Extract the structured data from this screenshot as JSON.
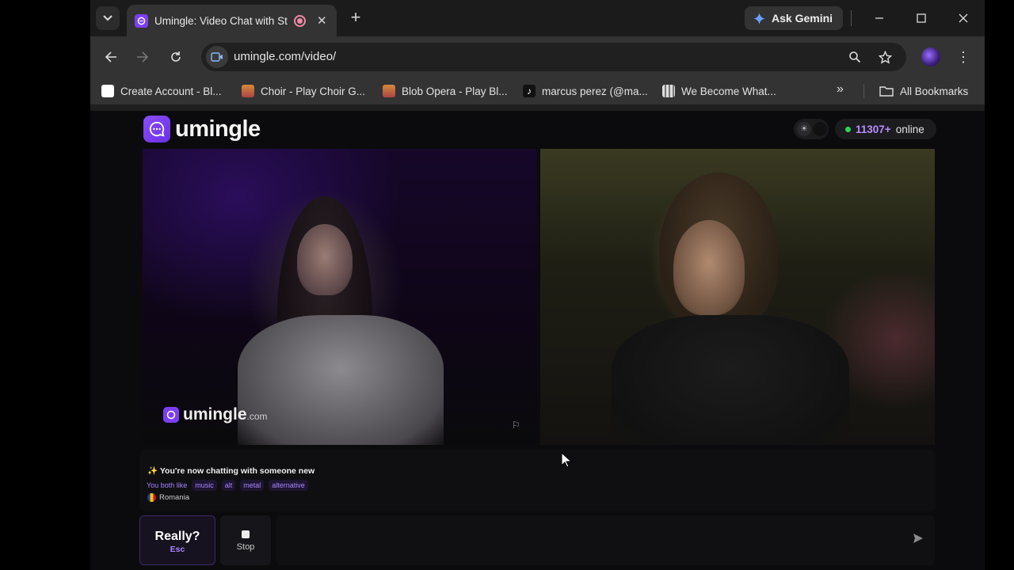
{
  "browser": {
    "tab_title": "Umingle: Video Chat with St",
    "new_tab_label": "+",
    "gemini_label": "Ask Gemini",
    "url": "umingle.com/video/",
    "bookmarks": [
      {
        "label": "Create Account - Bl...",
        "icon_color": "#ffffff"
      },
      {
        "label": "Choir - Play Choir G...",
        "icon_color": "#d6893b"
      },
      {
        "label": "Blob Opera - Play Bl...",
        "icon_color": "#d6893b"
      },
      {
        "label": "marcus perez (@ma...",
        "icon_color": "#ffffff"
      },
      {
        "label": "We Become What...",
        "icon_color": "#cccccc"
      }
    ],
    "all_bookmarks_label": "All Bookmarks"
  },
  "site": {
    "logo_text": "umingle",
    "online_count": "11307+",
    "online_label": "online",
    "accent_color": "#7b3ff2",
    "watermark_text": "umingle",
    "watermark_suffix": ".com"
  },
  "chat": {
    "status_message": "You're now chatting with someone new",
    "likes_label": "You both like",
    "tags": [
      "music",
      "alt",
      "metal",
      "alternative"
    ],
    "country": "Romania"
  },
  "controls": {
    "next_label": "Really?",
    "next_shortcut": "Esc",
    "stop_label": "Stop",
    "message_placeholder": ""
  }
}
